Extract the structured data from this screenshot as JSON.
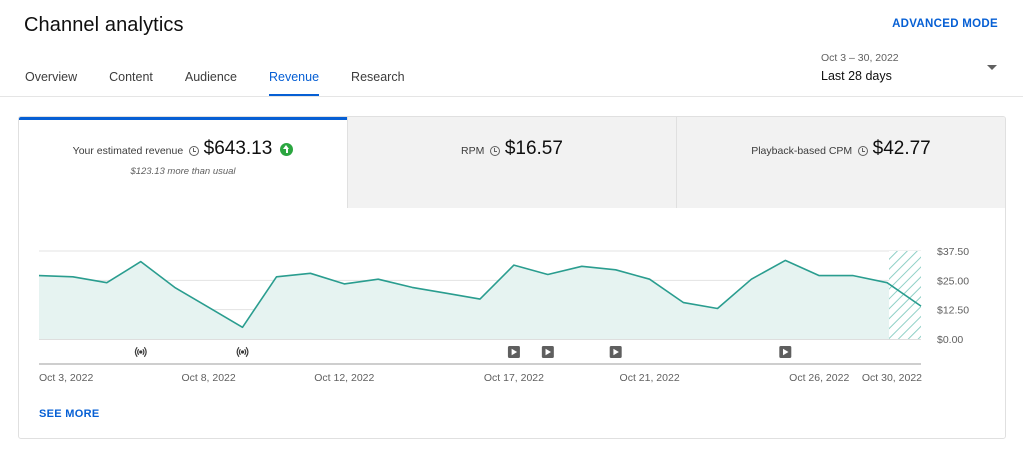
{
  "header": {
    "title": "Channel analytics",
    "advanced_mode": "ADVANCED MODE"
  },
  "tabs": [
    {
      "label": "Overview",
      "active": false
    },
    {
      "label": "Content",
      "active": false
    },
    {
      "label": "Audience",
      "active": false
    },
    {
      "label": "Revenue",
      "active": true
    },
    {
      "label": "Research",
      "active": false
    }
  ],
  "date_range": {
    "dates": "Oct 3 – 30, 2022",
    "label": "Last 28 days"
  },
  "metrics": [
    {
      "label": "Your estimated revenue",
      "value": "$643.13",
      "note": "$123.13 more than usual",
      "trend": "up"
    },
    {
      "label": "RPM",
      "value": "$16.57"
    },
    {
      "label": "Playback-based CPM",
      "value": "$42.77"
    }
  ],
  "see_more": "SEE MORE",
  "colors": {
    "accent": "#065fd4",
    "series": "#2a9d8f",
    "fill": "#e6f3f1",
    "trend_up": "#2ba640"
  },
  "chart_data": {
    "type": "area",
    "series": [
      {
        "values": [
          27.0,
          26.5,
          24.0,
          33.0,
          22.0,
          13.5,
          5.0,
          26.5,
          28.0,
          23.5,
          25.5,
          22.0,
          19.5,
          17.0,
          31.5,
          27.5,
          31.0,
          29.5,
          25.5,
          15.5,
          13.0,
          25.5,
          33.5,
          27.0,
          27.0,
          24.0,
          14.0
        ]
      }
    ],
    "x_ticks": [
      "Oct 3, 2022",
      "Oct 8, 2022",
      "Oct 12, 2022",
      "Oct 17, 2022",
      "Oct 21, 2022",
      "Oct 26, 2022",
      "Oct 30, 2022"
    ],
    "x_tick_index": [
      0,
      5,
      9,
      14,
      18,
      23,
      27
    ],
    "y_ticks": [
      "$37.50",
      "$25.00",
      "$12.50",
      "$0.00"
    ],
    "y_tick_values": [
      37.5,
      25,
      12.5,
      0
    ],
    "ylim": [
      0,
      37.5
    ],
    "grid": true,
    "incomplete_last_day": true,
    "markers": [
      {
        "type": "live-stream-icon",
        "index": 3
      },
      {
        "type": "live-stream-icon",
        "index": 6
      },
      {
        "type": "video-upload-icon",
        "index": 14
      },
      {
        "type": "video-upload-icon",
        "index": 15
      },
      {
        "type": "video-upload-icon",
        "index": 17
      },
      {
        "type": "video-upload-icon",
        "index": 22
      }
    ]
  }
}
